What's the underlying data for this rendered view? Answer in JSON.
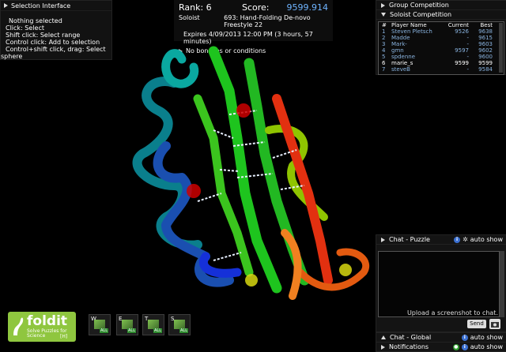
{
  "selection": {
    "title": "Selection Interface",
    "lines": [
      "Nothing selected",
      "Click: Select",
      "Shift click: Select range",
      "Control click: Add to selection",
      "Control+shift click, drag: Select",
      "sphere"
    ]
  },
  "puzzle": {
    "rank_label": "Rank: 6",
    "score_label": "Score:",
    "score_value": "9599.914",
    "mode": "Soloist",
    "puzzle_name": "693: Hand-Folding De-novo Freestyle 22",
    "expires": "Expires 4/09/2013 12:00 PM (3 hours, 57 minutes)",
    "conditions": "No bonuses or conditions"
  },
  "competition": {
    "group_label": "Group Competition",
    "soloist_label": "Soloist Competition",
    "headers": [
      "#",
      "Player Name",
      "Current",
      "Best"
    ],
    "rows": [
      {
        "rank": "1",
        "name": "Steven Pletsch",
        "current": "9526",
        "best": "9638"
      },
      {
        "rank": "2",
        "name": "Madde",
        "current": "-",
        "best": "9615"
      },
      {
        "rank": "3",
        "name": "Mark-",
        "current": "-",
        "best": "9603"
      },
      {
        "rank": "4",
        "name": "gmn",
        "current": "9597",
        "best": "9602"
      },
      {
        "rank": "5",
        "name": "spdenne",
        "current": "-",
        "best": "9600"
      },
      {
        "rank": "6",
        "name": "marie_s",
        "current": "9599",
        "best": "9599"
      },
      {
        "rank": "7",
        "name": "steveB",
        "current": "-",
        "best": "9584"
      }
    ]
  },
  "chat_puzzle": {
    "title": "Chat - Puzzle",
    "auto_show": "auto show",
    "hint": "Upload a screenshot to chat.",
    "send": "Send"
  },
  "chat_global": {
    "title": "Chat - Global",
    "auto_show": "auto show"
  },
  "notifications": {
    "title": "Notifications",
    "auto_show": "auto show"
  },
  "logo": {
    "name": "foldit",
    "tagline": "Solve Puzzles for Science",
    "hotkey": "[H]"
  },
  "tools": [
    {
      "key": "W",
      "badge": "ALL"
    },
    {
      "key": "E",
      "badge": "ALL"
    },
    {
      "key": "T",
      "badge": "ALL"
    },
    {
      "key": "S",
      "badge": "ALL"
    }
  ],
  "colors": {
    "accent": "#6fb4ff",
    "logo_green": "#8fc63f",
    "panel": "#121212"
  }
}
